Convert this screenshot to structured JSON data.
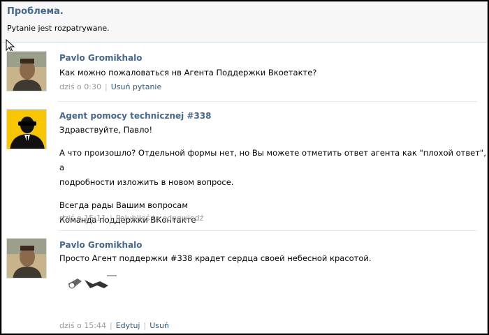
{
  "problem": {
    "title": "Проблема.",
    "status": "Pytanie jest rozpatrywane."
  },
  "posts": [
    {
      "author": "Pavlo Gromikhalo",
      "lines": [
        "Как можно пожаловаться нв Агента Поддержки Вкоетакте?"
      ],
      "time": "dziś o 0:30",
      "actions": [
        "Usuń pytanie"
      ]
    },
    {
      "author": "Agent pomocy technicznej #338",
      "lines": [
        "Здравствуйте, Павло!",
        "",
        "А что произошло? Отдельной формы нет, но Вы можете отметить ответ агента как \"плохой ответ\", а",
        "подробности изложить в новом вопросе.",
        "",
        "Всегда рады Вашим вопросам",
        "Команда поддержки ВКонтакте"
      ],
      "time": "dziś o 15:11",
      "actions": [
        "Polubiłeś tą odpowiedź"
      ]
    },
    {
      "author": "Pavlo Gromikhalo",
      "lines": [
        "Просто Агент поддержки #338 крадет сердца своей небесной красотой."
      ],
      "time": "dziś o 15:44",
      "actions": [
        "Edytuj",
        "Usuń"
      ]
    }
  ],
  "icons": {
    "cursor": "mouse-pointer-icon",
    "user_avatar": "user-photo",
    "agent_avatar": "agent-silhouette-icon"
  },
  "colors": {
    "link": "#45688e",
    "meta": "#999999",
    "background": "#ffffff"
  }
}
